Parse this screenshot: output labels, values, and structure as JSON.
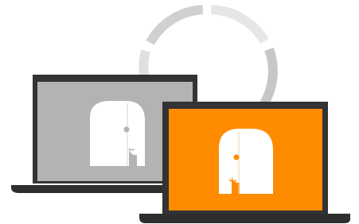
{
  "illustration": {
    "icon": "laptop-pair-with-sync-ring-illustration",
    "colors": {
      "background": "#ffffff",
      "laptop_frame": "#333333",
      "laptop_base": "#2e2e2e",
      "back_screen": "#b3b3b3",
      "front_screen": "#ff8c00",
      "face": "#ffffff",
      "face_line": "#d6d6d6",
      "back_eye": "#b3b3b3",
      "front_eye": "#ff8c00",
      "ring_light": "#e6e6e6",
      "ring_dark": "#c7c7c7"
    },
    "items": [
      {
        "name": "sync-ring",
        "icon": "circular-arrows-icon"
      },
      {
        "name": "back-laptop",
        "icon": "laptop-icon",
        "screen_color": "gray"
      },
      {
        "name": "front-laptop",
        "icon": "laptop-icon",
        "screen_color": "orange"
      },
      {
        "name": "face-icon",
        "icon": "face-profile-icon"
      }
    ]
  }
}
